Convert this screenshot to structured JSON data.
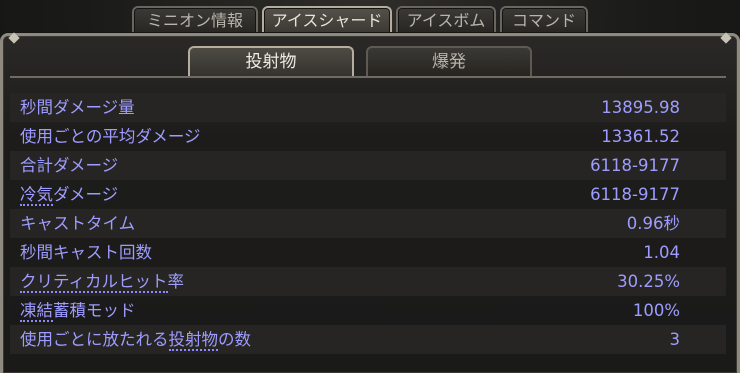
{
  "top_tabs": [
    {
      "label": "ミニオン情報",
      "active": false
    },
    {
      "label": "アイスシャード",
      "active": true
    },
    {
      "label": "アイスボム",
      "active": false
    },
    {
      "label": "コマンド",
      "active": false
    }
  ],
  "sub_tabs": [
    {
      "label": "投射物",
      "active": true
    },
    {
      "label": "爆発",
      "active": false
    }
  ],
  "stats": [
    {
      "label": "秒間ダメージ量",
      "value": "13895.98"
    },
    {
      "label": "使用ごとの平均ダメージ",
      "value": "13361.52"
    },
    {
      "label": "合計ダメージ",
      "value": "6118-9177"
    },
    {
      "label": "冷気ダメージ",
      "value": "6118-9177",
      "tooltip_term": "冷気"
    },
    {
      "label": "キャストタイム",
      "value": "0.96秒"
    },
    {
      "label": "秒間キャスト回数",
      "value": "1.04"
    },
    {
      "label": "クリティカルヒット率",
      "value": "30.25%",
      "tooltip_term": "クリティカルヒット"
    },
    {
      "label": "凍結蓄積モッド",
      "value": "100%",
      "tooltip_term": "凍結"
    },
    {
      "label_prefix": "使用ごとに放たれる",
      "label_term": "投射物",
      "label_suffix": "の数",
      "value": "3",
      "tooltip_term": "投射物"
    }
  ],
  "colors": {
    "stat_text": "#9e9cff",
    "background": "#1a1a19",
    "frame_border": "#8f8a80",
    "active_tab_text": "#e7e3da"
  }
}
